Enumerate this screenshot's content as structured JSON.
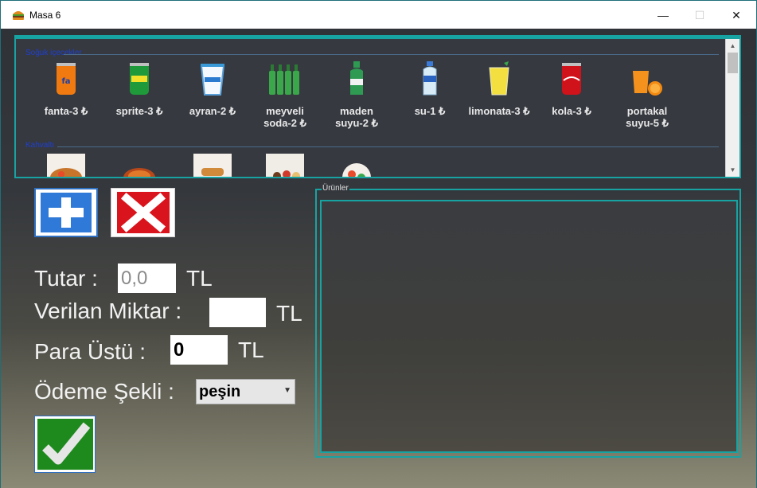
{
  "window": {
    "title": "Masa 6",
    "min": "—",
    "max": "☐",
    "close": "✕"
  },
  "groups": [
    {
      "header": "Soğuk içecekler",
      "items": [
        {
          "label1": "fanta-3 ₺",
          "label2": "",
          "icon": "fanta-can-icon",
          "color": "#f07a10"
        },
        {
          "label1": "sprite-3 ₺",
          "label2": "",
          "icon": "sprite-can-icon",
          "color": "#1f9a3a"
        },
        {
          "label1": "ayran-2 ₺",
          "label2": "",
          "icon": "ayran-cup-icon",
          "color": "#e8f4ff"
        },
        {
          "label1": "meyveli",
          "label2": "soda-2 ₺",
          "icon": "soda-bottles-icon",
          "color": "#3aa84a"
        },
        {
          "label1": "maden",
          "label2": "suyu-2 ₺",
          "icon": "mineral-water-bottle-icon",
          "color": "#2e9a52"
        },
        {
          "label1": "su-1 ₺",
          "label2": "",
          "icon": "water-bottle-icon",
          "color": "#d8ecf8"
        },
        {
          "label1": "limonata-3 ₺",
          "label2": "",
          "icon": "lemonade-glass-icon",
          "color": "#f3e040"
        },
        {
          "label1": "kola-3 ₺",
          "label2": "",
          "icon": "cola-can-icon",
          "color": "#d0121a"
        },
        {
          "label1": "portakal",
          "label2": "suyu-5 ₺",
          "icon": "orange-juice-icon",
          "color": "#f5921e"
        }
      ]
    },
    {
      "header": "Kahvaltı",
      "items": [
        {
          "icon": "breakfast-plate-1-icon"
        },
        {
          "icon": "breakfast-plate-2-icon"
        },
        {
          "icon": "breakfast-plate-3-icon"
        },
        {
          "icon": "breakfast-plate-4-icon"
        },
        {
          "icon": "breakfast-plate-5-icon"
        }
      ]
    }
  ],
  "form": {
    "tutar_label": "Tutar :",
    "tutar_value": "0,0",
    "verilen_label": "Verilan Miktar :",
    "verilen_value": "",
    "para_label": "Para Üstü :",
    "para_value": "0",
    "odeme_label": "Ödeme Şekli :",
    "odeme_value": "peşin",
    "currency": "TL"
  },
  "urunler": {
    "title": "Ürünler"
  },
  "colors": {
    "accent": "#18a3a3",
    "add_blue": "#2f6fc0",
    "delete_red": "#d9141c",
    "ok_green": "#1e8a1e"
  }
}
